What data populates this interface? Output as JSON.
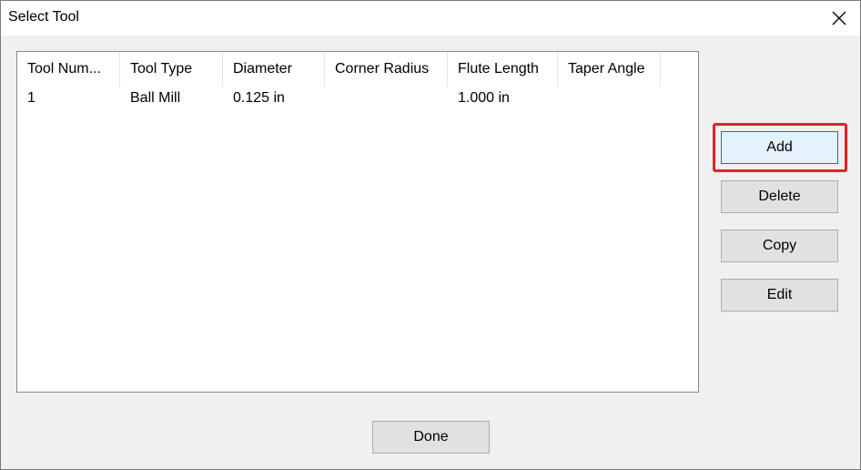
{
  "window": {
    "title": "Select Tool",
    "close_icon": "close-icon"
  },
  "table": {
    "columns": [
      "Tool Num...",
      "Tool Type",
      "Diameter",
      "Corner Radius",
      "Flute Length",
      "Taper Angle"
    ],
    "rows": [
      [
        "1",
        "Ball Mill",
        "0.125 in",
        "",
        "1.000 in",
        ""
      ]
    ]
  },
  "buttons": {
    "add": "Add",
    "delete": "Delete",
    "copy": "Copy",
    "edit": "Edit",
    "done": "Done"
  },
  "colors": {
    "highlight": "#e32028",
    "focus_border": "#0078d7"
  }
}
